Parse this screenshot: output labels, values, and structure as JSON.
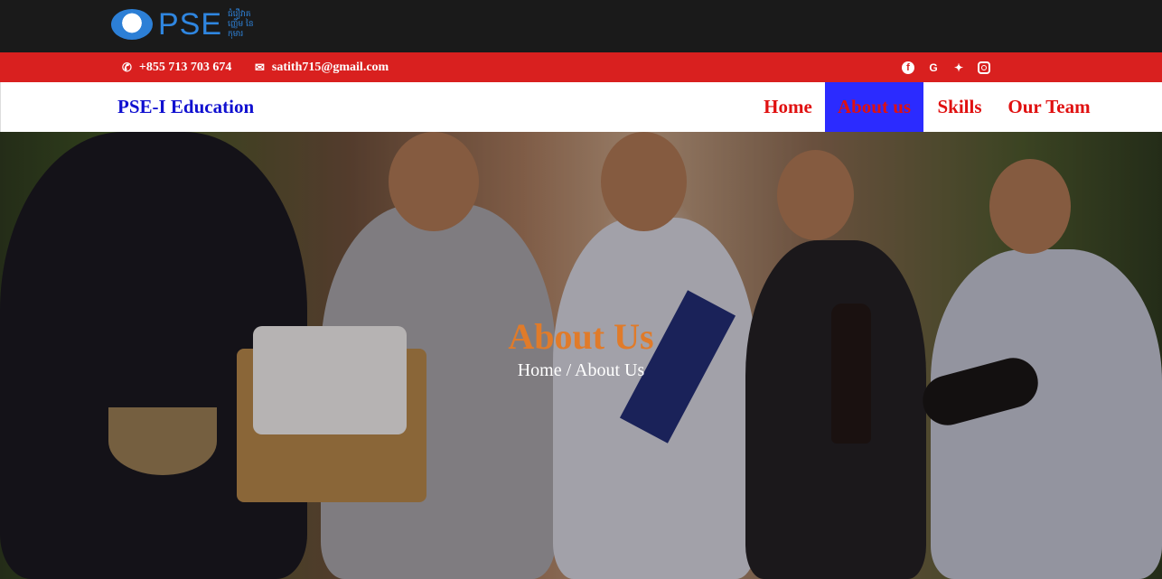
{
  "logo": {
    "text": "PSE",
    "subtext": "ជំរឿវាគ ញ្ញើម នៃកុមារ"
  },
  "contact": {
    "phone": "+855 713 703 674",
    "email": "satith715@gmail.com",
    "phone_icon": "phone-icon",
    "email_icon": "envelope-icon"
  },
  "social": [
    "facebook-icon",
    "google-icon",
    "twitter-icon",
    "instagram-icon"
  ],
  "navbar": {
    "brand": "PSE-I Education",
    "items": [
      {
        "label": "Home",
        "active": false
      },
      {
        "label": "About us",
        "active": true
      },
      {
        "label": "Skills",
        "active": false
      },
      {
        "label": "Our Team",
        "active": false
      }
    ]
  },
  "hero": {
    "title": "About Us",
    "breadcrumb_home": "Home",
    "breadcrumb_separator": " / ",
    "breadcrumb_current": "About Us"
  },
  "colors": {
    "contact_bar": "#d9201f",
    "nav_text": "#e01010",
    "nav_active_bg": "#2b2bff",
    "brand_text": "#1010d0",
    "hero_title": "#e07b2a"
  }
}
